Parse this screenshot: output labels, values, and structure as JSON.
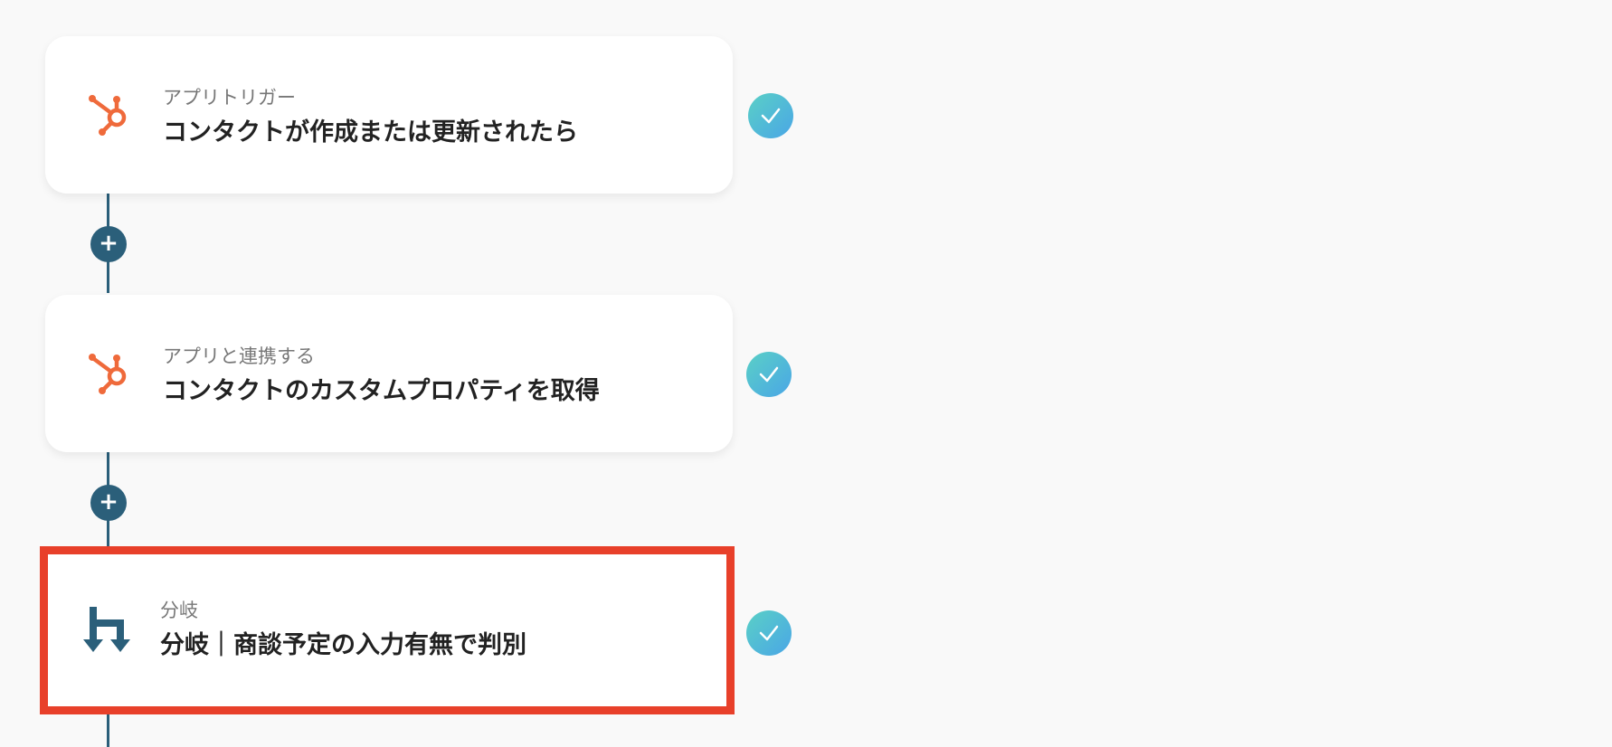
{
  "colors": {
    "accent": "#2b5f7a",
    "hubspot": "#ef6a3b",
    "highlight": "#e8402a",
    "check_start": "#5ad0c6",
    "check_end": "#4aa6e6"
  },
  "steps": [
    {
      "icon": "hubspot-icon",
      "label": "アプリトリガー",
      "title": "コンタクトが作成または更新されたら",
      "status": "completed"
    },
    {
      "icon": "hubspot-icon",
      "label": "アプリと連携する",
      "title": "コンタクトのカスタムプロパティを取得",
      "status": "completed"
    },
    {
      "icon": "branch-icon",
      "label": "分岐",
      "title": "分岐｜商談予定の入力有無で判別",
      "status": "completed",
      "selected": true
    }
  ],
  "add_step_symbol": "+"
}
